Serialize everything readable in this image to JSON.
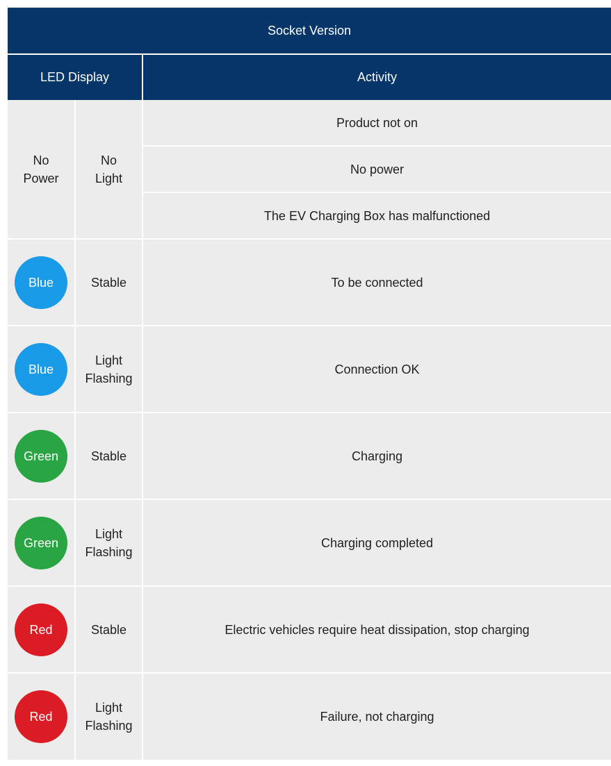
{
  "table": {
    "title": "Socket Version",
    "col_led": "LED Display",
    "col_activity": "Activity",
    "no_power_row": {
      "led": "No\nPower",
      "state": "No\nLight",
      "activities": [
        "Product not on",
        "No power",
        "The EV Charging Box has malfunctioned"
      ]
    },
    "rows": [
      {
        "color_name": "Blue",
        "color": "#1a9be8",
        "state": "Stable",
        "activity": "To be connected"
      },
      {
        "color_name": "Blue",
        "color": "#1a9be8",
        "state": "Light\nFlashing",
        "activity": "Connection OK"
      },
      {
        "color_name": "Green",
        "color": "#2aa543",
        "state": "Stable",
        "activity": "Charging"
      },
      {
        "color_name": "Green",
        "color": "#2aa543",
        "state": "Light\nFlashing",
        "activity": "Charging completed"
      },
      {
        "color_name": "Red",
        "color": "#dc1c24",
        "state": "Stable",
        "activity": "Electric vehicles require heat dissipation, stop charging"
      },
      {
        "color_name": "Red",
        "color": "#dc1c24",
        "state": "Light\nFlashing",
        "activity": "Failure, not charging"
      }
    ]
  }
}
